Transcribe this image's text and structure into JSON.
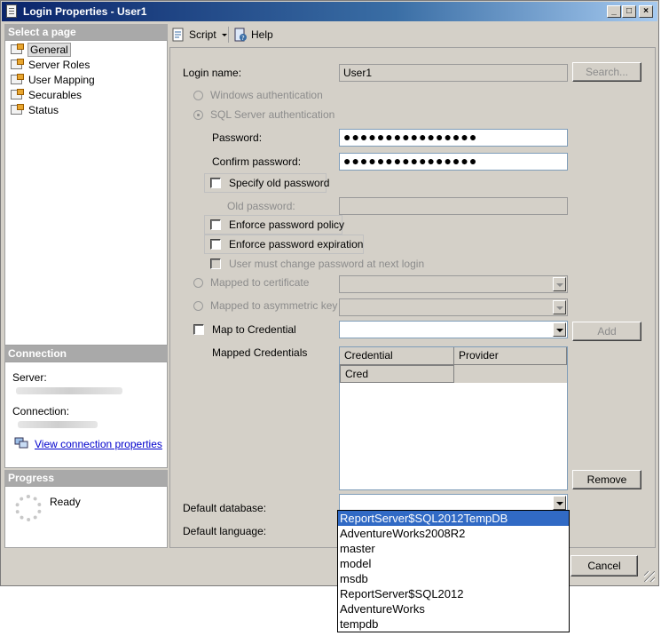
{
  "window": {
    "title": "Login Properties - User1",
    "controls": [
      "_",
      "□",
      "×"
    ]
  },
  "sidebar": {
    "select_page_header": "Select a page",
    "pages": [
      {
        "label": "General",
        "icon": "page-icon",
        "selected": true
      },
      {
        "label": "Server Roles",
        "icon": "page-icon"
      },
      {
        "label": "User Mapping",
        "icon": "page-icon"
      },
      {
        "label": "Securables",
        "icon": "page-icon"
      },
      {
        "label": "Status",
        "icon": "page-icon"
      }
    ],
    "connection_header": "Connection",
    "server_label": "Server:",
    "connection_label": "Connection:",
    "view_connection_link": "View connection properties",
    "progress_header": "Progress",
    "progress_status": "Ready"
  },
  "toolbar": {
    "script_label": "Script",
    "help_label": "Help"
  },
  "general": {
    "login_name_label": "Login name:",
    "login_name_value": "User1",
    "search_button": "Search...",
    "windows_auth_label": "Windows authentication",
    "sql_auth_label": "SQL Server authentication",
    "password_label": "Password:",
    "password_value": "●●●●●●●●●●●●●●●●",
    "confirm_password_label": "Confirm password:",
    "confirm_password_value": "●●●●●●●●●●●●●●●●",
    "specify_old_password_label": "Specify old password",
    "old_password_label": "Old password:",
    "enforce_policy_label": "Enforce password policy",
    "enforce_expiration_label": "Enforce password expiration",
    "must_change_label": "User must change password at next login",
    "mapped_certificate_label": "Mapped to certificate",
    "mapped_asym_key_label": "Mapped to asymmetric key",
    "map_credential_label": "Map to Credential",
    "add_button": "Add",
    "mapped_credentials_label": "Mapped Credentials",
    "grid_headers": [
      "Credential",
      "Provider"
    ],
    "grid_rows": [
      [
        "Cred",
        ""
      ]
    ],
    "remove_button": "Remove",
    "default_database_label": "Default database:",
    "default_language_label": "Default language:",
    "cancel_button": "Cancel"
  },
  "database_dropdown": {
    "options": [
      "ReportServer$SQL2012TempDB",
      "AdventureWorks2008R2",
      "master",
      "model",
      "msdb",
      "ReportServer$SQL2012",
      "AdventureWorks",
      "tempdb"
    ],
    "highlighted_index": 0
  },
  "colors": {
    "title_gradient_start": "#0a246a",
    "title_gradient_end": "#a6caf0",
    "dialog_background": "#d4d0c8",
    "selection_highlight": "#316ac5",
    "link": "#0000cc"
  }
}
